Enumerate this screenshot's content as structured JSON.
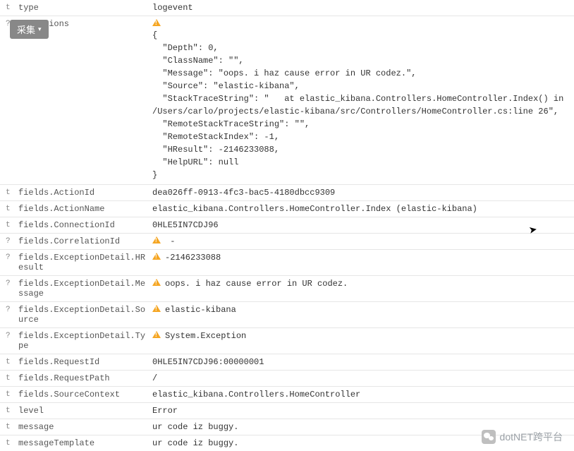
{
  "overlay": {
    "label": "采集",
    "chevron": "▾"
  },
  "watermark": {
    "text": "dotNET跨平台"
  },
  "exceptions_json": "{\n  \"Depth\": 0,\n  \"ClassName\": \"\",\n  \"Message\": \"oops. i haz cause error in UR codez.\",\n  \"Source\": \"elastic-kibana\",\n  \"StackTraceString\": \"   at elastic_kibana.Controllers.HomeController.Index() in /Users/carlo/projects/elastic-kibana/src/Controllers/HomeController.cs:line 26\",\n  \"RemoteStackTraceString\": \"\",\n  \"RemoteStackIndex\": -1,\n  \"HResult\": -2146233088,\n  \"HelpURL\": null\n}",
  "rows": [
    {
      "t": "t",
      "key": "type",
      "warn": false,
      "val": "logevent"
    },
    {
      "t": "?",
      "key": "exceptions",
      "warn": true,
      "val": "__JSON__"
    },
    {
      "t": "t",
      "key": "fields.ActionId",
      "warn": false,
      "val": "dea026ff-0913-4fc3-bac5-4180dbcc9309"
    },
    {
      "t": "t",
      "key": "fields.ActionName",
      "warn": false,
      "val": "elastic_kibana.Controllers.HomeController.Index (elastic-kibana)"
    },
    {
      "t": "t",
      "key": "fields.ConnectionId",
      "warn": false,
      "val": "0HLE5IN7CDJ96"
    },
    {
      "t": "?",
      "key": "fields.CorrelationId",
      "warn": true,
      "val": " -"
    },
    {
      "t": "?",
      "key": "fields.ExceptionDetail.HResult",
      "warn": true,
      "val": "-2146233088"
    },
    {
      "t": "?",
      "key": "fields.ExceptionDetail.Message",
      "warn": true,
      "val": "oops. i haz cause error in UR codez."
    },
    {
      "t": "?",
      "key": "fields.ExceptionDetail.Source",
      "warn": true,
      "val": "elastic-kibana"
    },
    {
      "t": "?",
      "key": "fields.ExceptionDetail.Type",
      "warn": true,
      "val": "System.Exception"
    },
    {
      "t": "t",
      "key": "fields.RequestId",
      "warn": false,
      "val": "0HLE5IN7CDJ96:00000001"
    },
    {
      "t": "t",
      "key": "fields.RequestPath",
      "warn": false,
      "val": "/"
    },
    {
      "t": "t",
      "key": "fields.SourceContext",
      "warn": false,
      "val": "elastic_kibana.Controllers.HomeController"
    },
    {
      "t": "t",
      "key": "level",
      "warn": false,
      "val": "Error"
    },
    {
      "t": "t",
      "key": "message",
      "warn": false,
      "val": "ur code iz buggy."
    },
    {
      "t": "t",
      "key": "messageTemplate",
      "warn": false,
      "val": "ur code iz buggy."
    }
  ]
}
